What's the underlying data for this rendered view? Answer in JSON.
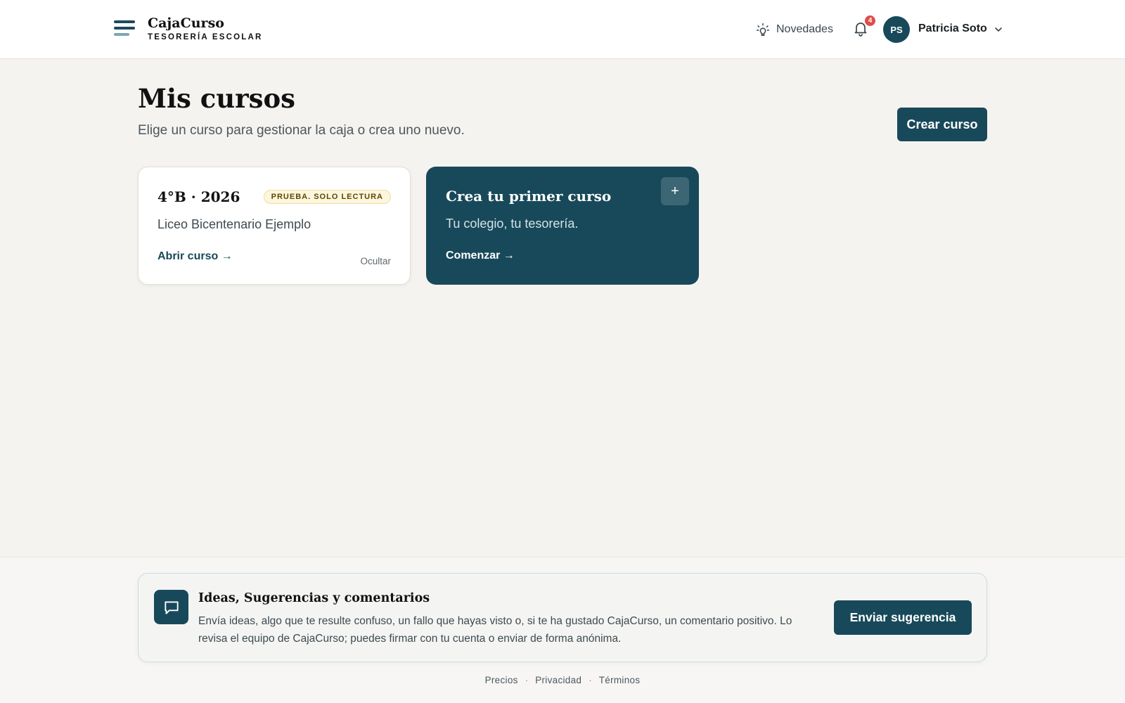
{
  "header": {
    "brand_name": "CajaCurso",
    "brand_subtitle": "TESORERÍA ESCOLAR",
    "news_label": "Novedades",
    "notification_count": "4",
    "user_initials": "PS",
    "user_name": "Patricia Soto"
  },
  "main": {
    "title": "Mis cursos",
    "subtitle": "Elige un curso para gestionar la caja o crea uno nuevo.",
    "create_button": "Crear curso",
    "courses": [
      {
        "title": "4°B · 2026",
        "badge": "PRUEBA. SOLO LECTURA",
        "school": "Liceo Bicentenario Ejemplo",
        "open_label": "Abrir curso →",
        "hide_label": "Ocultar"
      }
    ],
    "new_course_card": {
      "title": "Crea tu primer curso",
      "subtitle": "Tu colegio, tu tesorería.",
      "action": "Comenzar →",
      "plus": "+"
    }
  },
  "feedback": {
    "title": "Ideas, Sugerencias y comentarios",
    "text": "Envía ideas, algo que te resulte confuso, un fallo que hayas visto o, si te ha gustado CajaCurso, un comentario positivo. Lo revisa el equipo de CajaCurso; puedes firmar con tu cuenta o enviar de forma anónima.",
    "button": "Enviar sugerencia"
  },
  "footer": {
    "links": [
      "Precios",
      "Privacidad",
      "Términos"
    ],
    "separator": "·"
  },
  "colors": {
    "primary": "#18495a",
    "background": "#f5f3f0",
    "badge_bg": "#fdf6de",
    "notification": "#e24b4b"
  },
  "icons": {
    "logo": "menu-lines-logo-icon",
    "news": "lightbulb-icon",
    "notifications": "bell-icon",
    "user_menu": "chevron-down-icon",
    "feedback": "chat-bubble-icon",
    "add": "plus-icon"
  }
}
